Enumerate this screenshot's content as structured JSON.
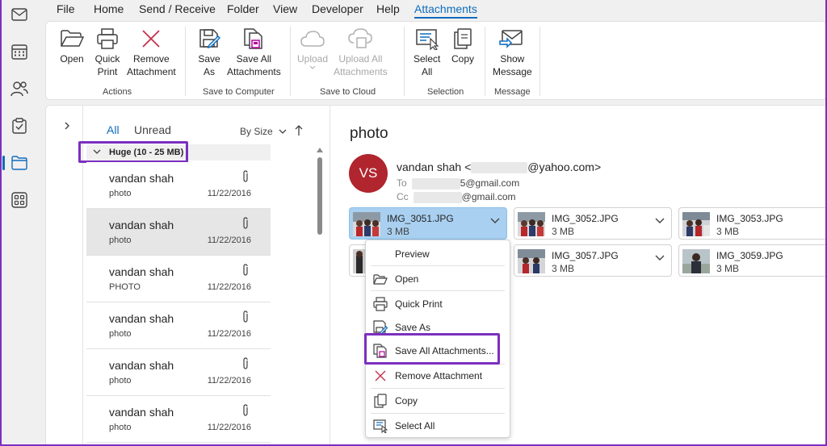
{
  "menu": {
    "items": [
      "File",
      "Home",
      "Send / Receive",
      "Folder",
      "View",
      "Developer",
      "Help",
      "Attachments"
    ],
    "active": "Attachments"
  },
  "ribbon": {
    "open": "Open",
    "quick_print_1": "Quick",
    "quick_print_2": "Print",
    "remove_1": "Remove",
    "remove_2": "Attachment",
    "actions_group": "Actions",
    "save_as_1": "Save",
    "save_as_2": "As",
    "save_all_1": "Save All",
    "save_all_2": "Attachments",
    "save_computer_group": "Save to Computer",
    "upload": "Upload",
    "upload_all_1": "Upload All",
    "upload_all_2": "Attachments",
    "save_cloud_group": "Save to Cloud",
    "select_all_1": "Select",
    "select_all_2": "All",
    "copy": "Copy",
    "selection_group": "Selection",
    "show_msg_1": "Show",
    "show_msg_2": "Message",
    "message_group": "Message"
  },
  "list": {
    "tab_all": "All",
    "tab_unread": "Unread",
    "sort": "By Size",
    "group_header": "Huge (10 - 25 MB)",
    "rows": [
      {
        "sender": "vandan shah",
        "subject": "photo",
        "date": "11/22/2016"
      },
      {
        "sender": "vandan shah",
        "subject": "photo",
        "date": "11/22/2016"
      },
      {
        "sender": "vandan shah",
        "subject": "PHOTO",
        "date": "11/22/2016"
      },
      {
        "sender": "vandan shah",
        "subject": "photo",
        "date": "11/22/2016"
      },
      {
        "sender": "vandan shah",
        "subject": "photo",
        "date": "11/22/2016"
      },
      {
        "sender": "vandan shah",
        "subject": "photo",
        "date": "11/22/2016"
      }
    ]
  },
  "reading": {
    "subject": "photo",
    "avatar": "VS",
    "from_name": "vandan shah <",
    "from_domain": "@yahoo.com>",
    "to_label": "To",
    "to_suffix": "5@gmail.com",
    "cc_label": "Cc",
    "cc_suffix": "@gmail.com"
  },
  "attachments": [
    {
      "name": "IMG_3051.JPG",
      "size": "3 MB"
    },
    {
      "name": "IMG_3052.JPG",
      "size": "3 MB"
    },
    {
      "name": "IMG_3053.JPG",
      "size": "3 MB"
    },
    {
      "name": "IMG_3057.JPG",
      "size": "3 MB"
    },
    {
      "name": "IMG_3059.JPG",
      "size": "3 MB"
    }
  ],
  "context_menu": {
    "preview": "Preview",
    "open": "Open",
    "quick_print": "Quick Print",
    "save_as": "Save As",
    "save_all": "Save All Attachments...",
    "remove": "Remove Attachment",
    "copy": "Copy",
    "select_all": "Select All"
  },
  "colors": {
    "accent": "#0f6cbd",
    "highlight": "#7b2fbf",
    "avatar": "#b0252e",
    "selected_attachment": "#a9d0f0"
  }
}
